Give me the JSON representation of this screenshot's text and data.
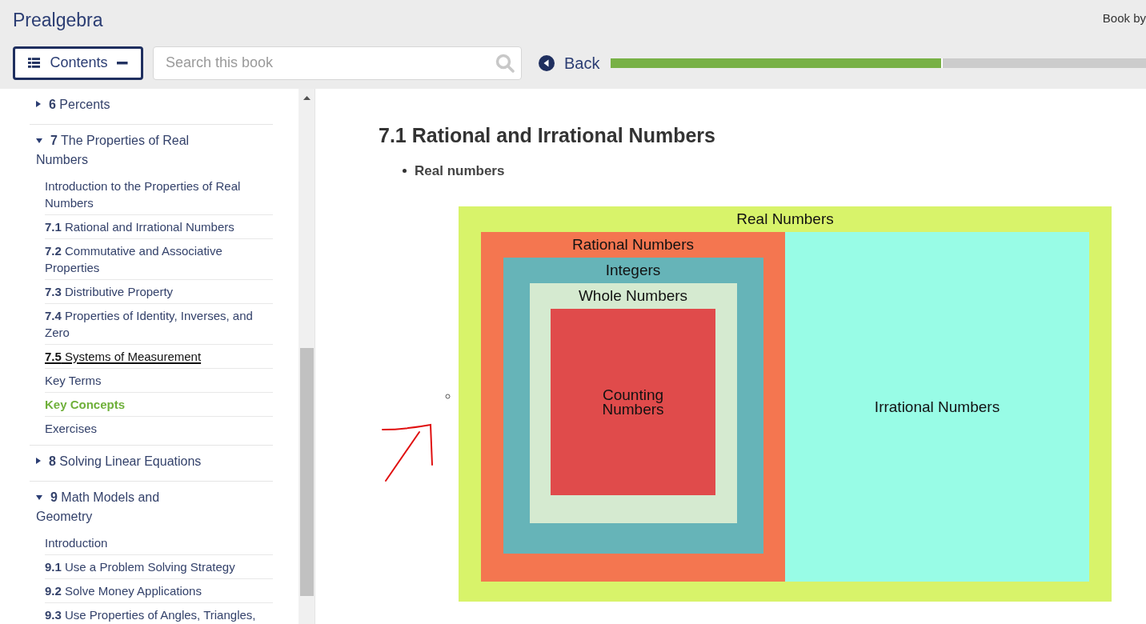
{
  "header": {
    "title": "Prealgebra",
    "attribution": "Book by",
    "contents_button": {
      "label": "Contents",
      "expanded": true
    },
    "search": {
      "placeholder": "Search this book"
    },
    "back": {
      "label": "Back"
    },
    "progress": {
      "level": 0.62
    }
  },
  "toc": [
    {
      "kind": "chapter",
      "number": "6",
      "title": "Percents",
      "expanded": false
    },
    {
      "kind": "chapter",
      "number": "7",
      "title": "The Properties of Real Numbers",
      "expanded": true,
      "children": [
        {
          "kind": "section",
          "title": "Introduction to the Properties of Real Numbers",
          "current": false,
          "selected": false
        },
        {
          "kind": "section",
          "number": "7.1",
          "title": "Rational and Irrational Numbers",
          "current": false,
          "selected": false
        },
        {
          "kind": "section",
          "number": "7.2",
          "title": "Commutative and Associative Properties",
          "current": false,
          "selected": false
        },
        {
          "kind": "section",
          "number": "7.3",
          "title": "Distributive Property",
          "current": false,
          "selected": false
        },
        {
          "kind": "section",
          "number": "7.4",
          "title": "Properties of Identity, Inverses, and Zero",
          "current": false,
          "selected": false
        },
        {
          "kind": "section",
          "number": "7.5",
          "title": "Systems of Measurement",
          "current": true,
          "selected": false
        },
        {
          "kind": "section",
          "title": "Key Terms",
          "current": false,
          "selected": false
        },
        {
          "kind": "section",
          "title": "Key Concepts",
          "current": false,
          "selected": true
        },
        {
          "kind": "section",
          "title": "Exercises",
          "current": false,
          "selected": false
        }
      ]
    },
    {
      "kind": "chapter",
      "number": "8",
      "title": "Solving Linear Equations",
      "expanded": false
    },
    {
      "kind": "chapter",
      "number": "9",
      "title": "Math Models and Geometry",
      "expanded": true,
      "children": [
        {
          "kind": "section",
          "title": "Introduction",
          "current": false,
          "selected": false
        },
        {
          "kind": "section",
          "number": "9.1",
          "title": "Use a Problem Solving Strategy",
          "current": false,
          "selected": false
        },
        {
          "kind": "section",
          "number": "9.2",
          "title": "Solve Money Applications",
          "current": false,
          "selected": false
        },
        {
          "kind": "section",
          "number": "9.3",
          "title": "Use Properties of Angles, Triangles,",
          "current": false,
          "selected": false
        }
      ]
    }
  ],
  "content": {
    "heading": "7.1 Rational and Irrational Numbers",
    "bullet": "Real numbers",
    "diagram": {
      "label": "Real Numbers",
      "color": "#d8f36a",
      "children": [
        {
          "label": "Rational Numbers",
          "color": "#f47650",
          "children": [
            {
              "label": "Integers",
              "color": "#66b4b8",
              "children": [
                {
                  "label": "Whole Numbers",
                  "color": "#d5ead0",
                  "children": [
                    {
                      "label": "Counting Numbers",
                      "color": "#e04b4b"
                    }
                  ]
                }
              ]
            }
          ]
        },
        {
          "label": "Irrational Numbers",
          "color": "#98fce6"
        }
      ]
    }
  }
}
